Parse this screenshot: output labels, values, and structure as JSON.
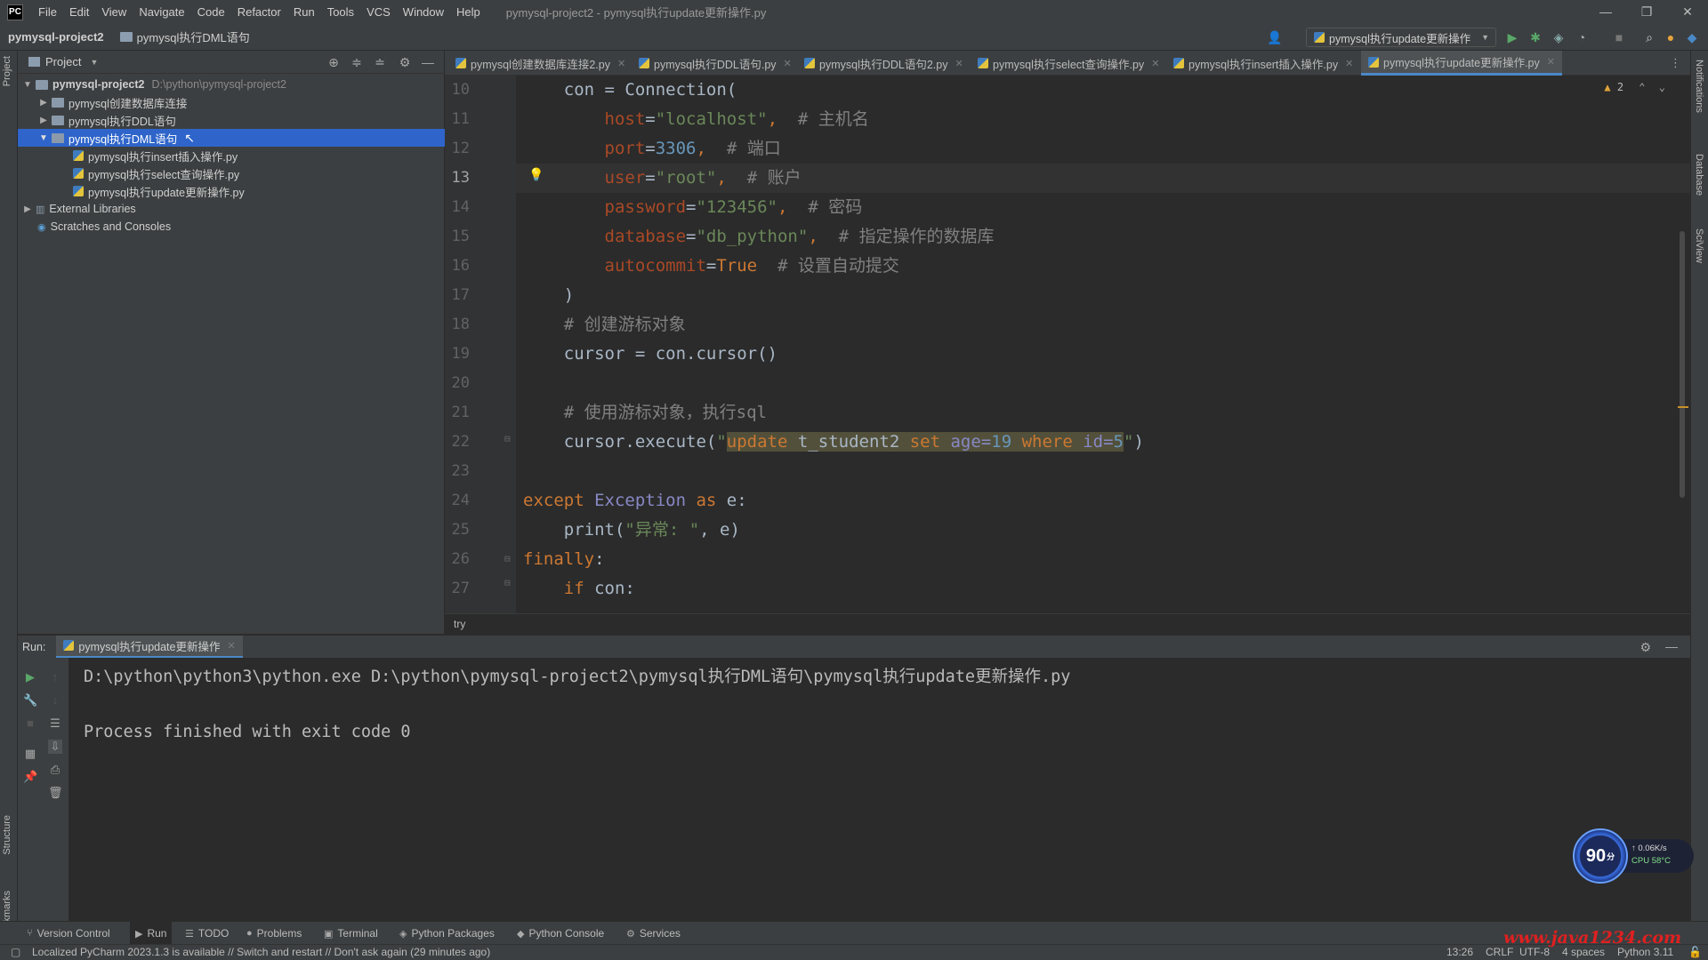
{
  "menubar": {
    "logo": "PC",
    "items": [
      "File",
      "Edit",
      "View",
      "Navigate",
      "Code",
      "Refactor",
      "Run",
      "Tools",
      "VCS",
      "Window",
      "Help"
    ],
    "window_title": "pymysql-project2 - pymysql执行update更新操作.py",
    "controls": [
      "—",
      "❐",
      "✕"
    ]
  },
  "navbar": {
    "project": "pymysql-project2",
    "folder": "pymysql执行DML语句",
    "run_config": "pymysql执行update更新操作"
  },
  "project_panel": {
    "title": "Project",
    "tree": [
      {
        "label": "pymysql-project2",
        "path": "D:\\python\\pymysql-project2"
      },
      {
        "label": "pymysql创建数据库连接"
      },
      {
        "label": "pymysql执行DDL语句"
      },
      {
        "label": "pymysql执行DML语句"
      },
      {
        "label": "pymysql执行insert插入操作.py"
      },
      {
        "label": "pymysql执行select查询操作.py"
      },
      {
        "label": "pymysql执行update更新操作.py"
      },
      {
        "label": "External Libraries"
      },
      {
        "label": "Scratches and Consoles"
      }
    ]
  },
  "editor_tabs": [
    {
      "label": "pymysql创建数据库连接2.py"
    },
    {
      "label": "pymysql执行DDL语句.py"
    },
    {
      "label": "pymysql执行DDL语句2.py"
    },
    {
      "label": "pymysql执行select查询操作.py"
    },
    {
      "label": "pymysql执行insert插入操作.py"
    },
    {
      "label": "pymysql执行update更新操作.py"
    }
  ],
  "editor": {
    "warning_count": "2",
    "line_numbers": [
      "10",
      "11",
      "12",
      "13",
      "14",
      "15",
      "16",
      "17",
      "18",
      "19",
      "20",
      "21",
      "22",
      "23",
      "24",
      "25",
      "26",
      "27"
    ],
    "current_line": "13",
    "lines": [
      [
        {
          "t": "    con = Connection(",
          "c": ""
        }
      ],
      [
        {
          "t": "        ",
          "c": ""
        },
        {
          "t": "host",
          "c": "param"
        },
        {
          "t": "=",
          "c": ""
        },
        {
          "t": "\"localhost\"",
          "c": "str"
        },
        {
          "t": ",  ",
          "c": "kw"
        },
        {
          "t": "# 主机名",
          "c": "cmt"
        }
      ],
      [
        {
          "t": "        ",
          "c": ""
        },
        {
          "t": "port",
          "c": "param"
        },
        {
          "t": "=",
          "c": ""
        },
        {
          "t": "3306",
          "c": "num"
        },
        {
          "t": ",  ",
          "c": "kw"
        },
        {
          "t": "# 端口",
          "c": "cmt"
        }
      ],
      [
        {
          "t": "        ",
          "c": ""
        },
        {
          "t": "user",
          "c": "param"
        },
        {
          "t": "=",
          "c": ""
        },
        {
          "t": "\"root\"",
          "c": "str"
        },
        {
          "t": ",  ",
          "c": "kw"
        },
        {
          "t": "# 账户",
          "c": "cmt"
        }
      ],
      [
        {
          "t": "        ",
          "c": ""
        },
        {
          "t": "password",
          "c": "param"
        },
        {
          "t": "=",
          "c": ""
        },
        {
          "t": "\"123456\"",
          "c": "str"
        },
        {
          "t": ",  ",
          "c": "kw"
        },
        {
          "t": "# 密码",
          "c": "cmt"
        }
      ],
      [
        {
          "t": "        ",
          "c": ""
        },
        {
          "t": "database",
          "c": "param"
        },
        {
          "t": "=",
          "c": ""
        },
        {
          "t": "\"db_python\"",
          "c": "str"
        },
        {
          "t": ",  ",
          "c": "kw"
        },
        {
          "t": "# 指定操作的数据库",
          "c": "cmt"
        }
      ],
      [
        {
          "t": "        ",
          "c": ""
        },
        {
          "t": "autocommit",
          "c": "param"
        },
        {
          "t": "=",
          "c": ""
        },
        {
          "t": "True",
          "c": "kw"
        },
        {
          "t": "  ",
          "c": ""
        },
        {
          "t": "# 设置自动提交",
          "c": "cmt"
        }
      ],
      [
        {
          "t": "    )",
          "c": ""
        }
      ],
      [
        {
          "t": "    ",
          "c": ""
        },
        {
          "t": "# 创建游标对象",
          "c": "cmt"
        }
      ],
      [
        {
          "t": "    cursor = con.cursor()",
          "c": ""
        }
      ],
      [
        {
          "t": "",
          "c": ""
        }
      ],
      [
        {
          "t": "    ",
          "c": ""
        },
        {
          "t": "# 使用游标对象，执行sql",
          "c": "cmt"
        }
      ],
      [
        {
          "t": "    cursor.execute(",
          "c": ""
        },
        {
          "t": "\"",
          "c": "str"
        },
        {
          "t": "update",
          "c": "kw hl-box"
        },
        {
          "t": " t_student2 ",
          "c": "hl-box"
        },
        {
          "t": "set",
          "c": "kw hl-box"
        },
        {
          "t": " age=",
          "c": "builtin hl-box"
        },
        {
          "t": "19",
          "c": "num hl-box"
        },
        {
          "t": " where ",
          "c": "kw hl-box"
        },
        {
          "t": "id=",
          "c": "builtin hl-box"
        },
        {
          "t": "5",
          "c": "num hl-box"
        },
        {
          "t": "\"",
          "c": "str"
        },
        {
          "t": ")",
          "c": ""
        }
      ],
      [
        {
          "t": "",
          "c": ""
        }
      ],
      [
        {
          "t": "except ",
          "c": "kw"
        },
        {
          "t": "Exception",
          "c": "builtin"
        },
        {
          "t": " as ",
          "c": "kw"
        },
        {
          "t": "e:",
          "c": ""
        }
      ],
      [
        {
          "t": "    print(",
          "c": ""
        },
        {
          "t": "\"异常: \"",
          "c": "str"
        },
        {
          "t": ", e)",
          "c": ""
        }
      ],
      [
        {
          "t": "finally",
          "c": "kw"
        },
        {
          "t": ":",
          "c": ""
        }
      ],
      [
        {
          "t": "    ",
          "c": ""
        },
        {
          "t": "if ",
          "c": "kw"
        },
        {
          "t": "con:",
          "c": ""
        }
      ]
    ]
  },
  "code_breadcrumb": "try",
  "run_panel": {
    "label": "Run:",
    "tab": "pymysql执行update更新操作",
    "console": [
      "D:\\python\\python3\\python.exe D:\\python\\pymysql-project2\\pymysql执行DML语句\\pymysql执行update更新操作.py",
      "",
      "Process finished with exit code 0"
    ]
  },
  "side_labels": {
    "left_top": "Project",
    "left_structure": "Structure",
    "left_bookmarks": "Bookmarks",
    "right_notifications": "Notifications",
    "right_database": "Database",
    "right_sciview": "SciView"
  },
  "toolwindows": [
    {
      "label": "Version Control",
      "icon": "branch-icon"
    },
    {
      "label": "Run",
      "icon": "run-icon"
    },
    {
      "label": "TODO",
      "icon": "list-icon"
    },
    {
      "label": "Problems",
      "icon": "problems-icon"
    },
    {
      "label": "Terminal",
      "icon": "terminal-icon"
    },
    {
      "label": "Python Packages",
      "icon": "packages-icon"
    },
    {
      "label": "Python Console",
      "icon": "python-console-icon"
    },
    {
      "label": "Services",
      "icon": "services-icon"
    }
  ],
  "statusbar": {
    "message": "Localized PyCharm 2023.1.3 is available // Switch and restart // Don't ask again (29 minutes ago)",
    "position": "13:26",
    "line_sep": "CRLF",
    "encoding": "UTF-8",
    "indent": "4 spaces",
    "interpreter": "Python 3.11"
  },
  "perf_widget": {
    "score": "90",
    "unit": "分",
    "net": "↑ 0.06K/s",
    "cpu": "CPU 58°C"
  },
  "watermark": "www.java1234.com",
  "colors": {
    "accent": "#2f65ca",
    "tab_underline": "#4a88c7",
    "keyword": "#cc7832",
    "string": "#6a8759",
    "number": "#6897bb",
    "comment": "#808080",
    "param": "#aa4926"
  }
}
